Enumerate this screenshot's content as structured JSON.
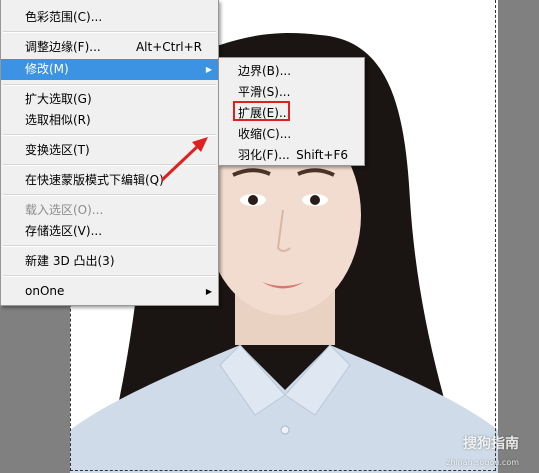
{
  "main_menu": {
    "items": [
      {
        "label": "色彩范围(C)...",
        "shortcut": "",
        "submenu": false,
        "highlighted": false,
        "disabled": false
      },
      {
        "label": "调整边缘(F)...",
        "shortcut": "Alt+Ctrl+R",
        "submenu": false,
        "highlighted": false,
        "disabled": false
      },
      {
        "label": "修改(M)",
        "shortcut": "",
        "submenu": true,
        "highlighted": true,
        "disabled": false
      },
      {
        "label": "扩大选取(G)",
        "shortcut": "",
        "submenu": false,
        "highlighted": false,
        "disabled": false
      },
      {
        "label": "选取相似(R)",
        "shortcut": "",
        "submenu": false,
        "highlighted": false,
        "disabled": false
      },
      {
        "label": "变换选区(T)",
        "shortcut": "",
        "submenu": false,
        "highlighted": false,
        "disabled": false
      },
      {
        "label": "在快速蒙版模式下编辑(Q)",
        "shortcut": "",
        "submenu": false,
        "highlighted": false,
        "disabled": false
      },
      {
        "label": "载入选区(O)...",
        "shortcut": "",
        "submenu": false,
        "highlighted": false,
        "disabled": true
      },
      {
        "label": "存储选区(V)...",
        "shortcut": "",
        "submenu": false,
        "highlighted": false,
        "disabled": false
      },
      {
        "label": "新建 3D 凸出(3)",
        "shortcut": "",
        "submenu": false,
        "highlighted": false,
        "disabled": false
      },
      {
        "label": "onOne",
        "shortcut": "",
        "submenu": true,
        "highlighted": false,
        "disabled": false
      }
    ],
    "submenu_arrow": "▶"
  },
  "sub_menu": {
    "items": [
      {
        "label": "边界(B)...",
        "shortcut": ""
      },
      {
        "label": "平滑(S)...",
        "shortcut": ""
      },
      {
        "label": "扩展(E)...",
        "shortcut": ""
      },
      {
        "label": "收缩(C)...",
        "shortcut": ""
      },
      {
        "label": "羽化(F)...",
        "shortcut": "Shift+F6"
      }
    ]
  },
  "watermark": {
    "text": "搜狗指南",
    "url": "zhinan.sogou.com"
  },
  "colors": {
    "highlight": "#3d93e3",
    "annotation_red": "#e02020",
    "menu_bg": "#f0f0f0"
  }
}
